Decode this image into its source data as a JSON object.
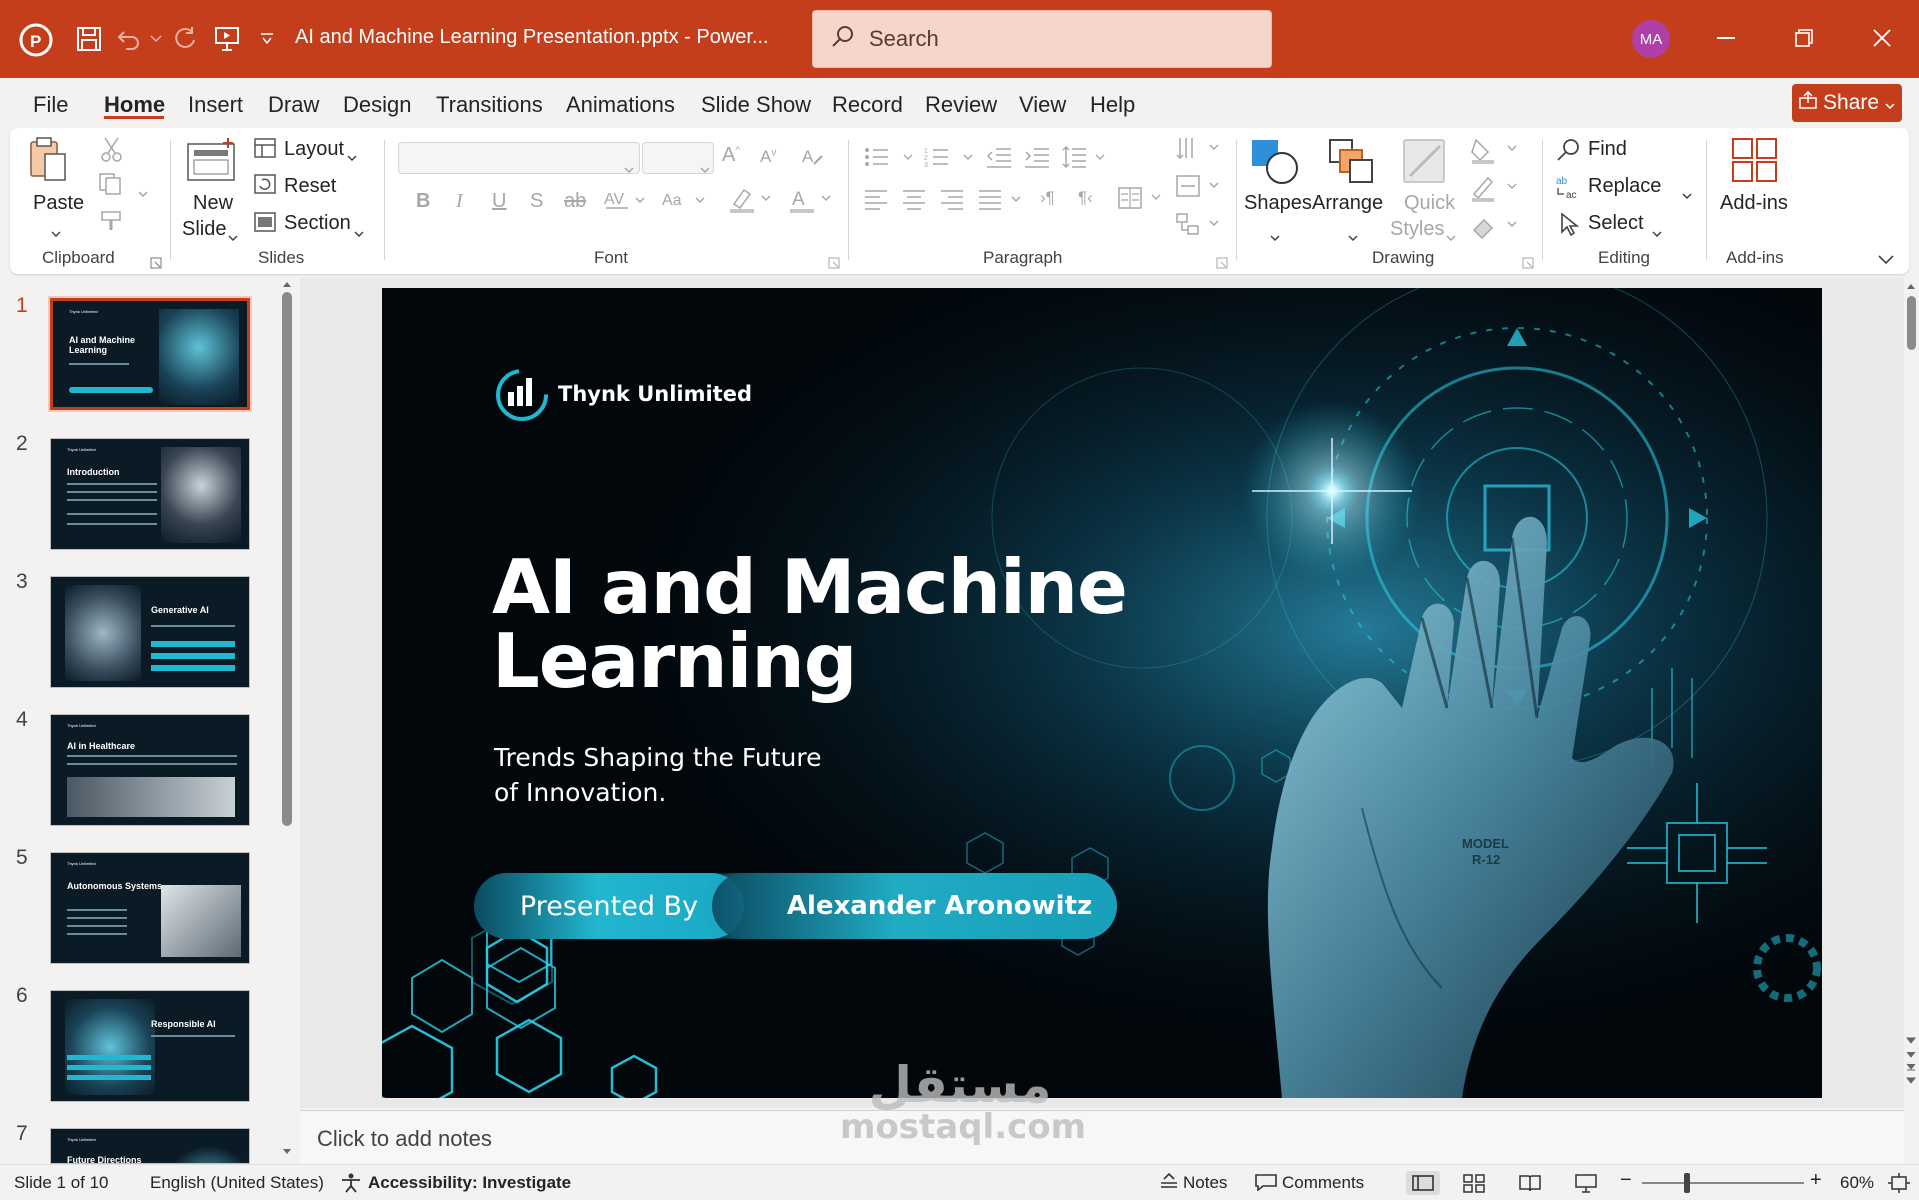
{
  "app": {
    "title": "AI and Machine Learning Presentation.pptx  -  Power...",
    "search_placeholder": "Search",
    "user_initials": "MA"
  },
  "menu": {
    "tabs": [
      "File",
      "Home",
      "Insert",
      "Draw",
      "Design",
      "Transitions",
      "Animations",
      "Slide Show",
      "Record",
      "Review",
      "View",
      "Help"
    ],
    "share": "Share"
  },
  "ribbon": {
    "clipboard": {
      "paste": "Paste",
      "label": "Clipboard"
    },
    "slides": {
      "new_slide_1": "New",
      "new_slide_2": "Slide",
      "layout": "Layout",
      "reset": "Reset",
      "section": "Section",
      "label": "Slides"
    },
    "font": {
      "bold": "B",
      "italic": "I",
      "underline": "U",
      "shadow": "S",
      "strike": "ab",
      "label": "Font"
    },
    "paragraph": {
      "label": "Paragraph"
    },
    "drawing": {
      "shapes": "Shapes",
      "arrange": "Arrange",
      "quick_1": "Quick",
      "quick_2": "Styles",
      "label": "Drawing"
    },
    "editing": {
      "find": "Find",
      "replace": "Replace",
      "select": "Select",
      "label": "Editing"
    },
    "addins": {
      "button": "Add-ins",
      "label": "Add-ins"
    }
  },
  "thumbnails": [
    {
      "num": "1",
      "title": "AI and Machine Learning"
    },
    {
      "num": "2",
      "title": "Introduction"
    },
    {
      "num": "3",
      "title": "Generative AI"
    },
    {
      "num": "4",
      "title": "AI in Healthcare"
    },
    {
      "num": "5",
      "title": "Autonomous Systems"
    },
    {
      "num": "6",
      "title": "Responsible AI"
    },
    {
      "num": "7",
      "title": "Future Directions"
    }
  ],
  "slide": {
    "brand": "Thynk Unlimited",
    "title_1": "AI and Machine",
    "title_2": "Learning",
    "subtitle_1": "Trends Shaping the Future",
    "subtitle_2": "of Innovation.",
    "presented_by": "Presented By",
    "presenter": "Alexander Aronowitz",
    "model_label_1": "MODEL",
    "model_label_2": "R-12"
  },
  "notes": {
    "placeholder": "Click to add notes"
  },
  "watermark": {
    "line1": "مستقل",
    "line2": "mostaql.com"
  },
  "status": {
    "slide_count": "Slide 1 of 10",
    "language": "English (United States)",
    "accessibility": "Accessibility: Investigate",
    "notes": "Notes",
    "comments": "Comments",
    "zoom": "60%",
    "zoom_level": 0.6
  },
  "colors": {
    "accent": "#c43e1c",
    "slide_teal": "#1fb8d0"
  }
}
